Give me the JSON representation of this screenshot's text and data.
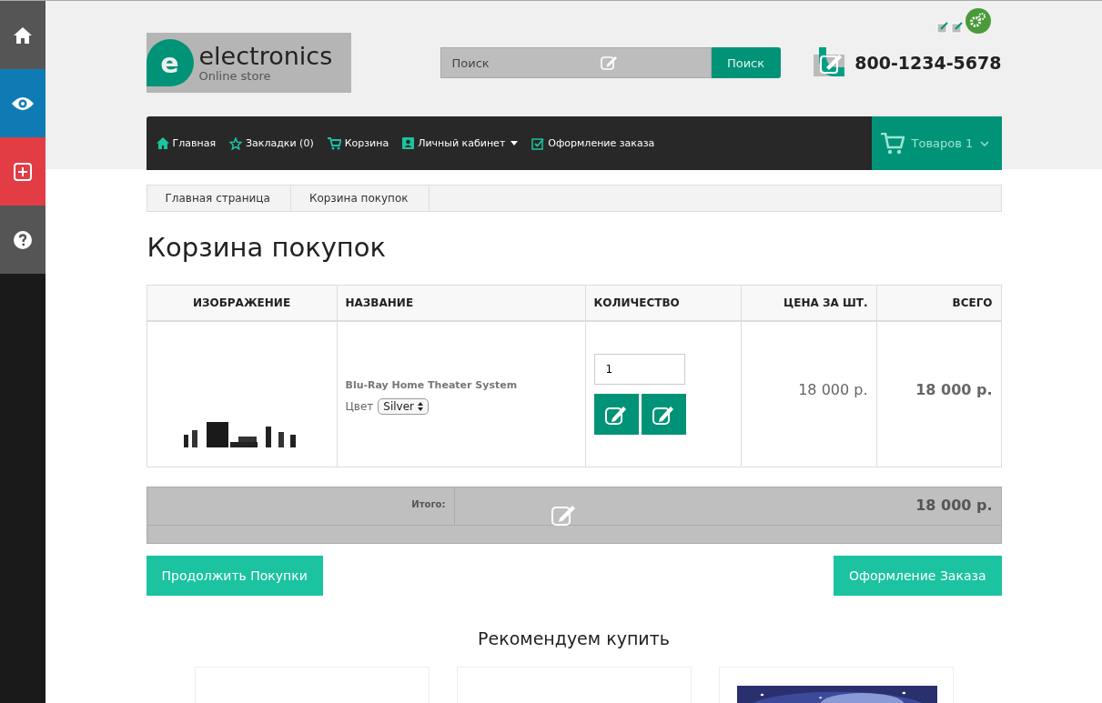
{
  "sidebar": [
    {
      "kind": "home",
      "color": "#555555"
    },
    {
      "kind": "eye",
      "color": "#0e7bb5"
    },
    {
      "kind": "plus",
      "color": "#e23d45"
    },
    {
      "kind": "help",
      "color": "#555555"
    }
  ],
  "logo": {
    "mark": "e",
    "name": "electronics",
    "tagline": "Online store"
  },
  "search": {
    "placeholder": "Поиск",
    "button": "Поиск"
  },
  "phone": "800-1234-5678",
  "nav": [
    {
      "kind": "home",
      "label": "Главная"
    },
    {
      "kind": "star",
      "label": "Закладки (0)"
    },
    {
      "kind": "cart",
      "label": "Корзина"
    },
    {
      "kind": "user",
      "label": "Личный кабинет",
      "dropdown": true
    },
    {
      "kind": "check",
      "label": "Оформление заказа"
    }
  ],
  "cart": {
    "label": "Товаров 1"
  },
  "breadcrumbs": [
    "Главная страница",
    "Корзина покупок"
  ],
  "title": "Корзина покупок",
  "table": {
    "columns": [
      "ИЗОБРАЖЕНИЕ",
      "НАЗВАНИЕ",
      "КОЛИЧЕСТВО",
      "ЦЕНА ЗА ШТ.",
      "ВСЕГО"
    ],
    "rows": [
      {
        "name": "Blu-Ray Home Theater System",
        "option_label": "Цвет",
        "option_value": "Silver",
        "quantity": "1",
        "price": "18 000 р.",
        "total": "18 000 р."
      }
    ]
  },
  "totals": {
    "label": "Итого:",
    "value": "18 000 р."
  },
  "buttons": {
    "continue": "Продолжить Покупки",
    "checkout": "Оформление Заказа"
  },
  "recommended": {
    "title": "Рекомендуем купить",
    "cards": [
      {
        "kind": "empty"
      },
      {
        "kind": "empty"
      },
      {
        "kind": "picture"
      }
    ]
  }
}
